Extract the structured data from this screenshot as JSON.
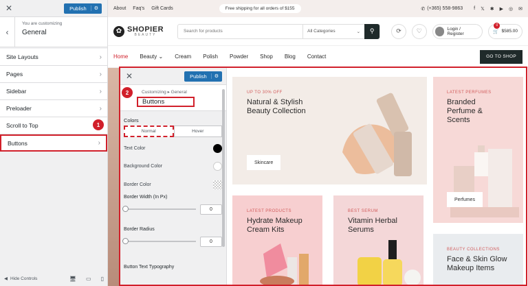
{
  "customizer": {
    "close": "✕",
    "publish": "Publish",
    "back": "‹",
    "context_sub": "You are customizing",
    "context_title": "General",
    "items": [
      "Site Layouts",
      "Pages",
      "Sidebar",
      "Preloader",
      "Scroll to Top",
      "Buttons"
    ],
    "badge_1": "1",
    "hide_controls": "Hide Controls"
  },
  "pane": {
    "close": "✕",
    "publish": "Publish",
    "badge_2": "2",
    "breadcrumb": "Customizing ▸ General",
    "title": "Buttons",
    "colors_label": "Colors",
    "tabs": [
      "Normal",
      "Hover"
    ],
    "text_color": "Text Color",
    "bg_color": "Background Color",
    "border_color": "Border Color",
    "border_width": "Border Width (In Px)",
    "border_width_value": "0",
    "border_radius": "Border Radius",
    "border_radius_value": "0",
    "typography": "Button Text Typography",
    "text_color_value": "#000000",
    "bg_color_value": "#ffffff"
  },
  "topbar": {
    "links": [
      "About",
      "Faq's",
      "Gift Cards"
    ],
    "shipping": "Free shipping for all orders of $155",
    "phone": "(+365) 558-9863",
    "socials": [
      "f",
      "𝕏",
      "✱",
      "▶",
      "◎",
      "✉"
    ]
  },
  "header": {
    "logo_name": "SHOPIER",
    "logo_tag": "BEAUTY",
    "search_placeholder": "Search for products",
    "category": "All Categories",
    "login": "Login / Register",
    "cart_count": "0",
    "cart_total": "$585.00"
  },
  "nav": {
    "items": [
      "Home",
      "Beauty ⌄",
      "Cream",
      "Polish",
      "Powder",
      "Shop",
      "Blog",
      "Contact"
    ],
    "goshop": "GO TO SHOP"
  },
  "cards": {
    "main": {
      "eyebrow": "UP TO 30% OFF",
      "title": "Natural & Stylish Beauty Collection",
      "button": "Skincare"
    },
    "perfume": {
      "eyebrow": "LATEST PERFUMES",
      "title": "Branded Perfume & Scents",
      "button": "Perfumes"
    },
    "hydrate": {
      "eyebrow": "LATEST PRODUCTS",
      "title": "Hydrate Makeup Cream Kits"
    },
    "vitamin": {
      "eyebrow": "BEST SERUM",
      "title": "Vitamin Herbal Serums"
    },
    "face": {
      "eyebrow": "BEAUTY COLLECTIONS",
      "title": "Face & Skin Glow Makeup Items"
    }
  },
  "colors": {
    "accent_red": "#d11f2a",
    "wp_blue": "#2271b1",
    "dark": "#1f2a2a"
  }
}
